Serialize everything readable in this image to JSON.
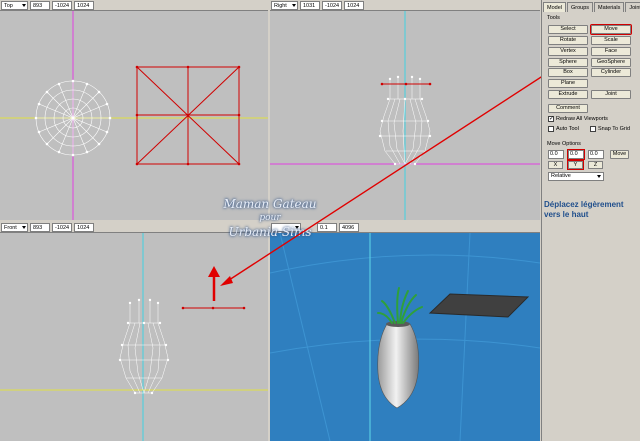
{
  "viewports": {
    "top": {
      "label": "Top",
      "x": "893",
      "y": "-1024",
      "z": "1024"
    },
    "right": {
      "label": "Right",
      "x": "1031",
      "y": "-1024",
      "z": "1024"
    },
    "front": {
      "label": "Front",
      "x": "893",
      "y": "-1024",
      "z": "1024"
    },
    "persp": {
      "near": "0.1",
      "far": "4096"
    }
  },
  "panel": {
    "tabs": [
      "Model",
      "Groups",
      "Materials",
      "Joints"
    ],
    "tools_title": "Tools",
    "tools": [
      "Select",
      "Move",
      "Rotate",
      "Scale",
      "Vertex",
      "Face",
      "Sphere",
      "GeoSphere",
      "Box",
      "Cylinder",
      "Plane",
      "Extrude",
      "Joint"
    ],
    "comment": "Comment",
    "redraw": "Redraw All Viewports",
    "auto_tool": "Auto Tool",
    "snap_grid": "Snap To Grid",
    "move_options_title": "Move Options",
    "move_x": "0.0",
    "move_y": "0.0",
    "move_z": "0.0",
    "move_btn": "Move",
    "axis_x": "X",
    "axis_y": "Y",
    "axis_z": "Z",
    "mode": "Relative"
  },
  "instruction": "Déplacez légèrement vers le haut",
  "watermark": {
    "line1": "Maman Gateau",
    "line2": "pour",
    "line3": "Urbania-Sims"
  },
  "colors": {
    "viewport_bg": "#bfbfbf",
    "persp_bg": "#2f7fbf",
    "selection": "#d00000",
    "x_axis": "#e0e040",
    "y_axis": "#40d0e0",
    "z_axis": "#e040e0"
  }
}
